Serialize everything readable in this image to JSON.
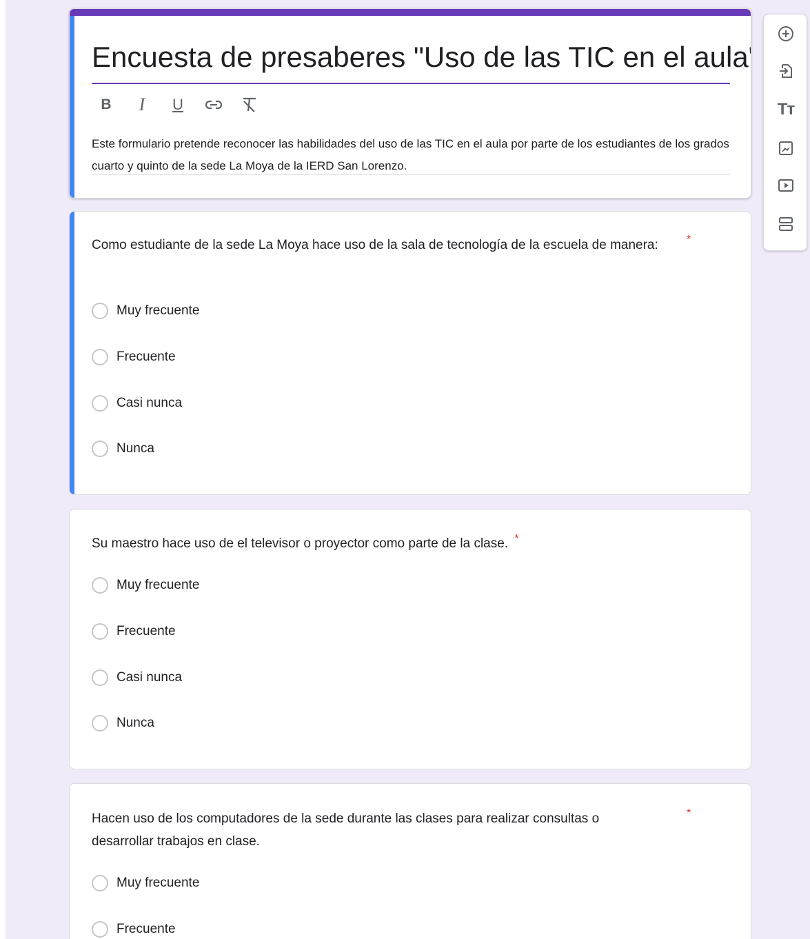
{
  "form": {
    "title": "Encuesta de presaberes \"Uso de las TIC en el aula\"",
    "description": "Este formulario pretende reconocer las habilidades del uso de las TIC en el aula por parte de los estudiantes de los grados cuarto y quinto de la sede La Moya de la IERD San Lorenzo.",
    "formatting": {
      "bold": "B",
      "italic": "I",
      "underline": "U"
    }
  },
  "side_toolbar": {
    "items": [
      "add-question-icon",
      "import-questions-icon",
      "add-title-icon",
      "add-image-icon",
      "add-video-icon",
      "add-section-icon"
    ],
    "title_glyph": "Tт"
  },
  "questions": [
    {
      "text": "Como estudiante de la sede La Moya hace uso de la sala de tecnología de la escuela de manera:",
      "required": "*",
      "options": [
        "Muy frecuente",
        "Frecuente",
        "Casi nunca",
        "Nunca"
      ]
    },
    {
      "text": "Su maestro hace uso de el televisor o proyector como parte de la clase.",
      "required": "*",
      "options": [
        "Muy frecuente",
        "Frecuente",
        "Casi nunca",
        "Nunca"
      ]
    },
    {
      "text": "Hacen uso de los computadores de la sede durante las clases para realizar consultas o desarrollar trabajos en clase.",
      "required": "*",
      "options": [
        "Muy frecuente",
        "Frecuente"
      ]
    }
  ],
  "colors": {
    "accent": "#673ab7",
    "active_marker": "#4285f4",
    "required": "#d93025",
    "background": "#f0ebf8"
  }
}
